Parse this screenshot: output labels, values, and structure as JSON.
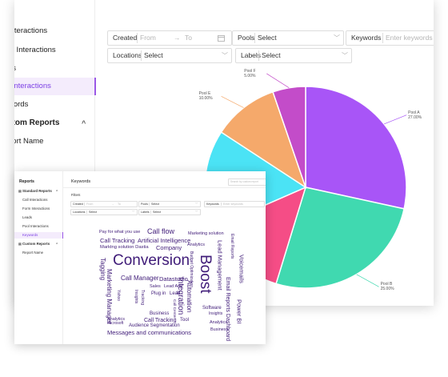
{
  "back": {
    "sidebar": {
      "items": [
        {
          "label": "Interactions"
        },
        {
          "label": "m Interactions"
        },
        {
          "label": "ds"
        },
        {
          "label": "l Interactions"
        },
        {
          "label": "words"
        },
        {
          "label": "stom Reports",
          "chevron": "^"
        },
        {
          "label": "port Name"
        }
      ]
    },
    "filters": {
      "created_label": "Created",
      "from_placeholder": "From",
      "arrow": "→",
      "to_placeholder": "To",
      "pools_label": "Pools",
      "pools_value": "Select",
      "keywords_label": "Keywords",
      "keywords_placeholder": "Enter keywords",
      "locations_label": "Locations",
      "locations_value": "Select",
      "labels_label": "Labels",
      "labels_value": "Select"
    }
  },
  "chart_data": {
    "type": "pie",
    "slices": [
      {
        "name": "Pool A",
        "value": 27.0,
        "label": "27.00%",
        "color": "#a855f7"
      },
      {
        "name": "Pool B",
        "value": 25.0,
        "label": "25.00%",
        "color": "#40d9b0"
      },
      {
        "name": "Pool C",
        "value": 13.0,
        "label": "",
        "color": "#f54d86"
      },
      {
        "name": "Pool D",
        "value": 15.0,
        "label": "",
        "color": "#4be3f5"
      },
      {
        "name": "Pool E",
        "value": 10.0,
        "label": "10.00%",
        "color": "#f5a96b"
      },
      {
        "name": "Pool F",
        "value": 5.0,
        "label": "5.00%",
        "color": "#c34cc9"
      }
    ]
  },
  "front": {
    "sidebar": {
      "title": "Reports",
      "items": [
        {
          "label": "Standard Reports",
          "chevron": "^"
        },
        {
          "label": "Call Interactions"
        },
        {
          "label": "Form Interactions"
        },
        {
          "label": "Leads"
        },
        {
          "label": "Pool Interactions"
        },
        {
          "label": "Keywords"
        },
        {
          "label": "Custom Reports",
          "chevron": "^"
        },
        {
          "label": "Report Name"
        }
      ]
    },
    "header": {
      "title": "Keywords",
      "search_placeholder": "Search by custom report"
    },
    "filters": {
      "title": "Filters",
      "created_label": "Created",
      "from_placeholder": "From",
      "arrow": "→",
      "to_placeholder": "To",
      "pools_label": "Pools",
      "pools_value": "Select",
      "keywords_label": "Keywords",
      "keywords_placeholder": "Enter keywords",
      "locations_label": "Locations",
      "locations_value": "Select",
      "labels_label": "Labels",
      "labels_value": "Select"
    },
    "wordcloud": [
      "Pay for what you use",
      "Call flow",
      "Marketing solution",
      "Call Tracking",
      "Artificial Intelligence",
      "Email Reports",
      "Marktng solution Dastia",
      "Company",
      "Lead Management",
      "Voicemails",
      "Conversion",
      "Boost",
      "Budget Optimization",
      "Tagging",
      "Marketing Manager",
      "Analytics",
      "Call Manager",
      "Datastudio",
      "Integration",
      "Automation",
      "Email Reports Dashboard",
      "Power BI",
      "Sales",
      "Lead Ads",
      "Plug in",
      "Lead",
      "Software",
      "Business",
      "Call Tracking",
      "Tool",
      "Analytics",
      "Microsoft",
      "Audience Segmentation",
      "Messages and communications",
      "Business",
      "Insights",
      "Yahoo",
      "Tracking",
      "Insights",
      "Analytics",
      "Call Center"
    ]
  }
}
